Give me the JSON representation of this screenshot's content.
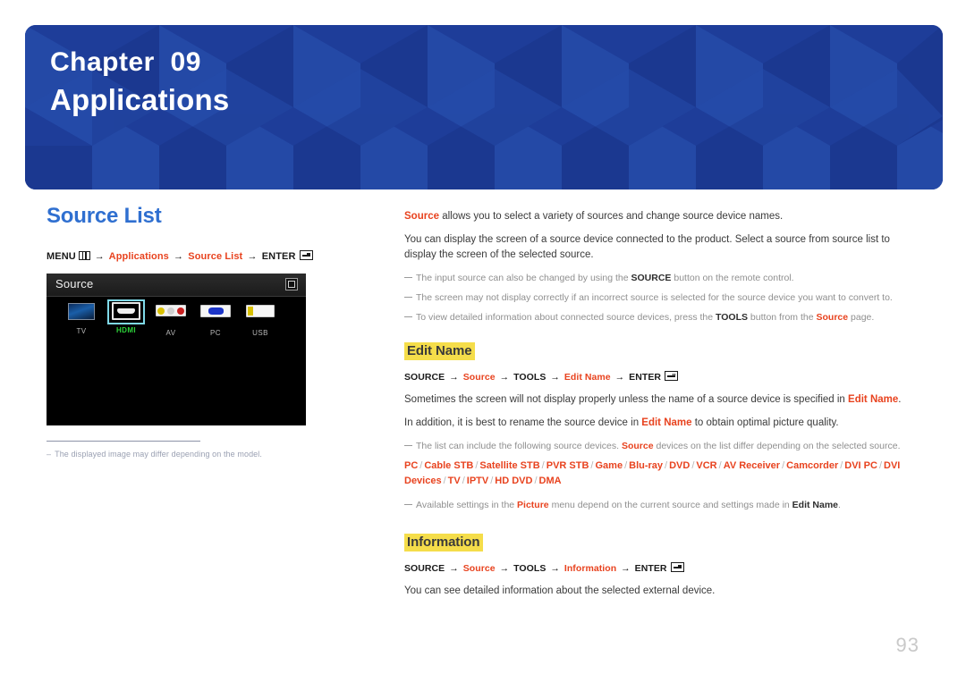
{
  "banner": {
    "chapter_label": "Chapter  09",
    "chapter_name": "Applications",
    "bg_color": "#1e3d99"
  },
  "left": {
    "section_title": "Source List",
    "nav_path": {
      "menu_label": "MENU",
      "menu_icon": "menu-grid-icon",
      "arrow": "→",
      "step1": "Applications",
      "step2": "Source List",
      "enter_label": "ENTER",
      "enter_icon": "enter-key-icon"
    },
    "tv_screenshot": {
      "title": "Source",
      "return_icon": "return-icon",
      "sources": [
        {
          "label": "TV",
          "icon": "tv-screen-icon",
          "selected": false
        },
        {
          "label": "HDMI",
          "icon": "hdmi-port-icon",
          "selected": true
        },
        {
          "label": "AV",
          "icon": "av-rca-jacks-icon",
          "selected": false
        },
        {
          "label": "PC",
          "icon": "vga-port-icon",
          "selected": false
        },
        {
          "label": "USB",
          "icon": "usb-port-icon",
          "selected": false
        }
      ]
    },
    "footnote": {
      "dash": "–",
      "text": "The displayed image may differ depending on the model."
    }
  },
  "right": {
    "intro": {
      "lead_term": "Source",
      "lead_rest": " allows you to select a variety of sources and change source device names.",
      "paragraph2": "You can display the screen of a source device connected to the product. Select a source from source list to display the screen of the selected source."
    },
    "intro_bullets": [
      {
        "parts": [
          {
            "t": "The input source can also be changed by using the ",
            "s": "plain"
          },
          {
            "t": "SOURCE",
            "s": "bold"
          },
          {
            "t": " button on the remote control.",
            "s": "plain"
          }
        ]
      },
      {
        "parts": [
          {
            "t": "The screen may not display correctly if an incorrect source is selected for the source device you want to convert to.",
            "s": "plain"
          }
        ]
      },
      {
        "parts": [
          {
            "t": "To view detailed information about connected source devices, press the ",
            "s": "plain"
          },
          {
            "t": "TOOLS",
            "s": "bold"
          },
          {
            "t": " button from the ",
            "s": "plain"
          },
          {
            "t": "Source",
            "s": "red"
          },
          {
            "t": " page.",
            "s": "plain"
          }
        ]
      }
    ],
    "edit_name": {
      "heading": "Edit Name",
      "cmd_path": {
        "source_label": "SOURCE",
        "arrow": "→",
        "step1": "Source",
        "step2": "TOOLS",
        "step3": "Edit Name",
        "enter_label": "ENTER",
        "enter_icon": "enter-key-icon"
      },
      "paragraphs": [
        {
          "parts": [
            {
              "t": "Sometimes the screen will not display properly unless the name of a source device is specified in ",
              "s": "plain"
            },
            {
              "t": "Edit Name",
              "s": "red"
            },
            {
              "t": ".",
              "s": "plain"
            }
          ]
        },
        {
          "parts": [
            {
              "t": "In addition, it is best to rename the source device in ",
              "s": "plain"
            },
            {
              "t": "Edit Name",
              "s": "red"
            },
            {
              "t": " to obtain optimal picture quality.",
              "s": "plain"
            }
          ]
        }
      ],
      "list_bullet": {
        "parts": [
          {
            "t": "The list can include the following source devices. ",
            "s": "plain"
          },
          {
            "t": "Source",
            "s": "red"
          },
          {
            "t": " devices on the list differ depending on the selected source.",
            "s": "plain"
          }
        ]
      },
      "device_list": [
        "PC",
        "Cable STB",
        "Satellite STB",
        "PVR STB",
        "Game",
        "Blu-ray",
        "DVD",
        "VCR",
        "AV Receiver",
        "Camcorder",
        "DVI PC",
        "DVI Devices",
        "TV",
        "IPTV",
        "HD DVD",
        "DMA"
      ],
      "picture_bullet": {
        "parts": [
          {
            "t": "Available settings in the ",
            "s": "plain"
          },
          {
            "t": "Picture",
            "s": "red"
          },
          {
            "t": " menu depend on the current source and settings made in ",
            "s": "plain"
          },
          {
            "t": "Edit Name",
            "s": "bold"
          },
          {
            "t": ".",
            "s": "plain"
          }
        ]
      }
    },
    "information": {
      "heading": "Information",
      "cmd_path": {
        "source_label": "SOURCE",
        "arrow": "→",
        "step1": "Source",
        "step2": "TOOLS",
        "step3": "Information",
        "enter_label": "ENTER",
        "enter_icon": "enter-key-icon"
      },
      "body": "You can see detailed information about the selected external device."
    }
  },
  "page_number": "93"
}
